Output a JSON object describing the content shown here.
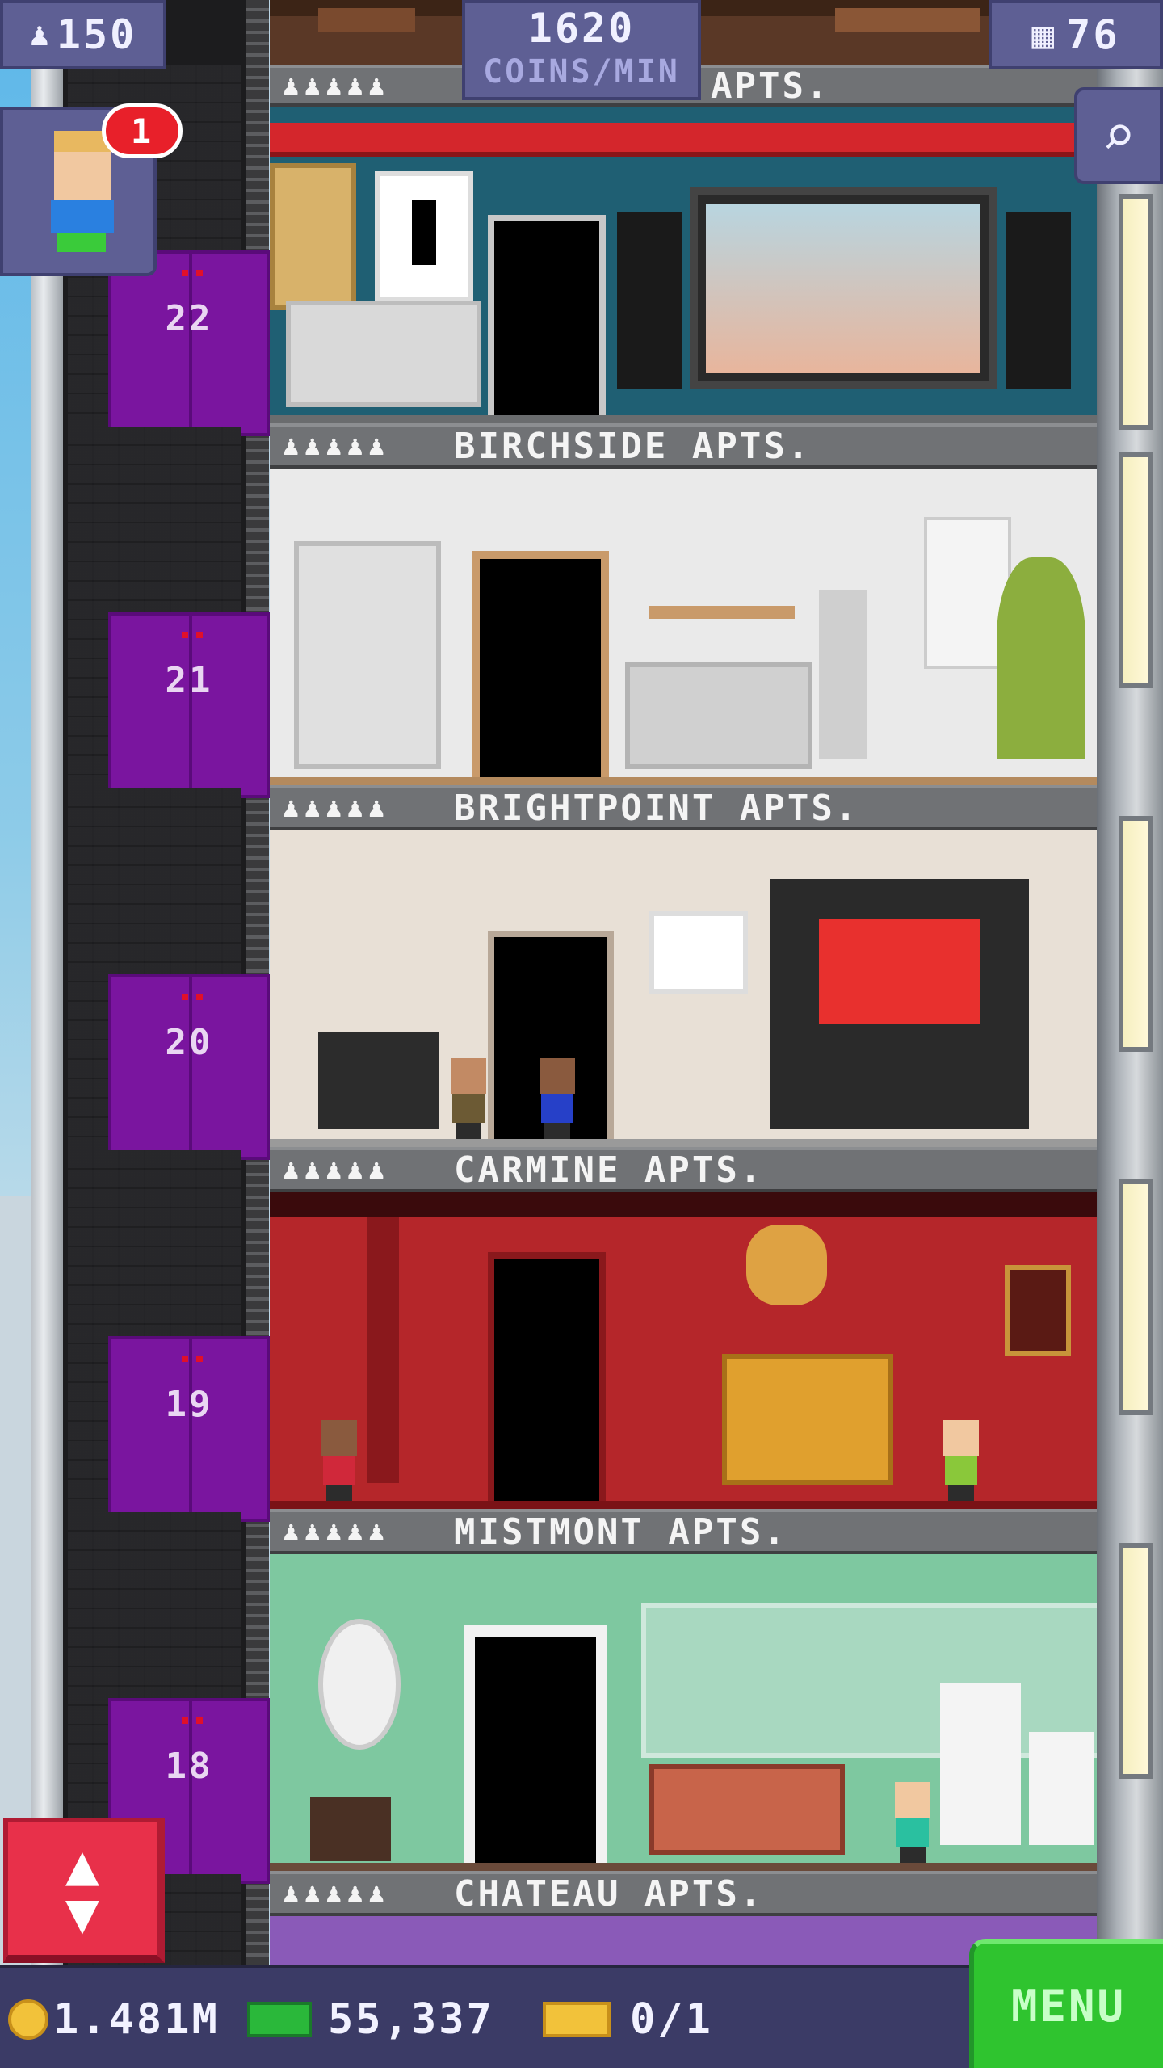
{
  "hud": {
    "population": "150",
    "coins_per_min_value": "1620",
    "coins_per_min_unit": "COINS/MIN",
    "floors": "76"
  },
  "notification": {
    "count": "1"
  },
  "top_floor": {
    "label_suffix": "APTS."
  },
  "floors": [
    {
      "number": "22",
      "name": "BIRCHSIDE APTS."
    },
    {
      "number": "21",
      "name": "BRIGHTPOINT APTS."
    },
    {
      "number": "20",
      "name": "CARMINE APTS."
    },
    {
      "number": "19",
      "name": "MISTMONT APTS."
    },
    {
      "number": "18",
      "name": "CHATEAU APTS."
    }
  ],
  "floor_rating_stars": "♟♟♟♟♟",
  "bottom": {
    "coins": "1.481M",
    "bux": "55,337",
    "tickets": "0/1",
    "menu_label": "MENU"
  },
  "elevator_button_symbol_up": "▲",
  "elevator_button_symbol_down": "▼",
  "colors": {
    "hud": "#5e5f94",
    "menu": "#2fc42f",
    "elevator_door": "#7a159f",
    "elevator_button": "#e8304a"
  }
}
